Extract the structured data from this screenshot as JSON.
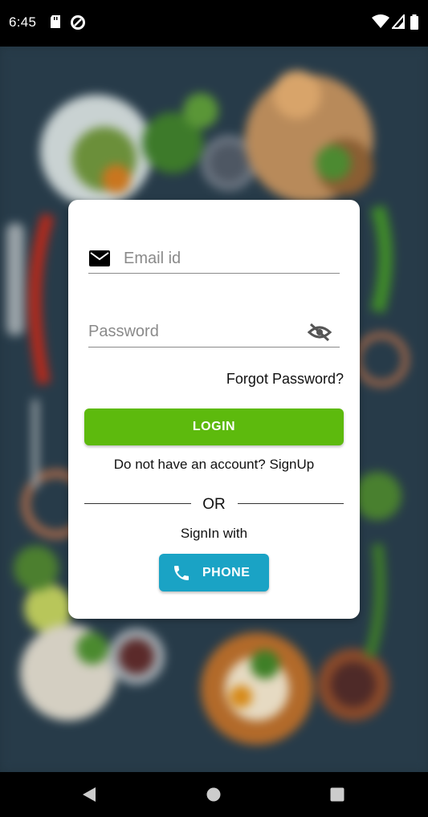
{
  "status_bar": {
    "time": "6:45",
    "icons": [
      "sd-card-icon",
      "data-saver-icon",
      "wifi-icon",
      "cellular-signal-icon",
      "battery-icon"
    ]
  },
  "background": {
    "description_icon": "food-background-image"
  },
  "login_form": {
    "email": {
      "placeholder": "Email id",
      "value": "",
      "icon": "mail-icon"
    },
    "password": {
      "placeholder": "Password",
      "value": "",
      "icon": "visibility-off-icon"
    },
    "forgot_password": "Forgot Password?",
    "login_button": "LOGIN",
    "signup_prompt": "Do not have an account? SignUp",
    "or_label": "OR",
    "signin_with": "SignIn with",
    "phone_button": "PHONE"
  },
  "colors": {
    "login_button": "#5dba0d",
    "phone_button": "#1aa3c5",
    "card": "#ffffff"
  },
  "nav_bar": {
    "buttons": [
      "back-icon",
      "home-icon",
      "recents-icon"
    ]
  }
}
